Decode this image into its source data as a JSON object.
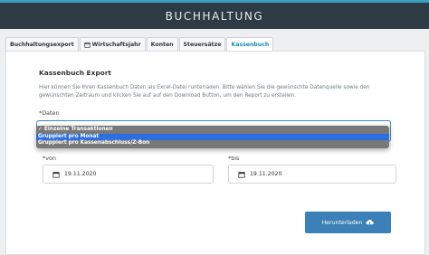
{
  "header": {
    "title": "BUCHHALTUNG"
  },
  "tabs": [
    {
      "label": "Buchhaltungsexport",
      "active": false
    },
    {
      "label": "Wirtschaftsjahr",
      "active": false,
      "icon": "calendar-icon"
    },
    {
      "label": "Konten",
      "active": false
    },
    {
      "label": "Steuersätze",
      "active": false
    },
    {
      "label": "Kassenbuch",
      "active": true
    }
  ],
  "panel": {
    "title": "Kassenbuch Export",
    "description": "Hier können Sie Ihren Kassenbuch Daten als Excel-Datei runterladen. Bitte wählen Sie die gewünschte Datenquelle sowie den gewünschten Zeitraum und klicken Sie auf auf den Download Button, um den Report zu erstellen.",
    "daten_label": "*Daten",
    "daten_options": [
      {
        "label": "✓ Einzelne Transaktionen",
        "selected": false
      },
      {
        "label": "Gruppiert pro Monat",
        "selected": true
      },
      {
        "label": "Gruppiert pro Kassenabschluss/Z-Bon",
        "selected": false
      }
    ],
    "von_label": "*von",
    "von_value": "19.11.2020",
    "bis_label": "*bis",
    "bis_value": "19.11.2020",
    "download_label": "Herunterladen",
    "download_icon": "cloud-download-icon"
  },
  "colors": {
    "header_bg": "#2f3b44",
    "accent": "#39a0bf",
    "active_tab_text": "#1a8ab5",
    "button_bg": "#3b80b6",
    "dropdown_bg": "#787878",
    "dropdown_selected": "#2d6fe0",
    "focus_border": "#3a86d9"
  }
}
